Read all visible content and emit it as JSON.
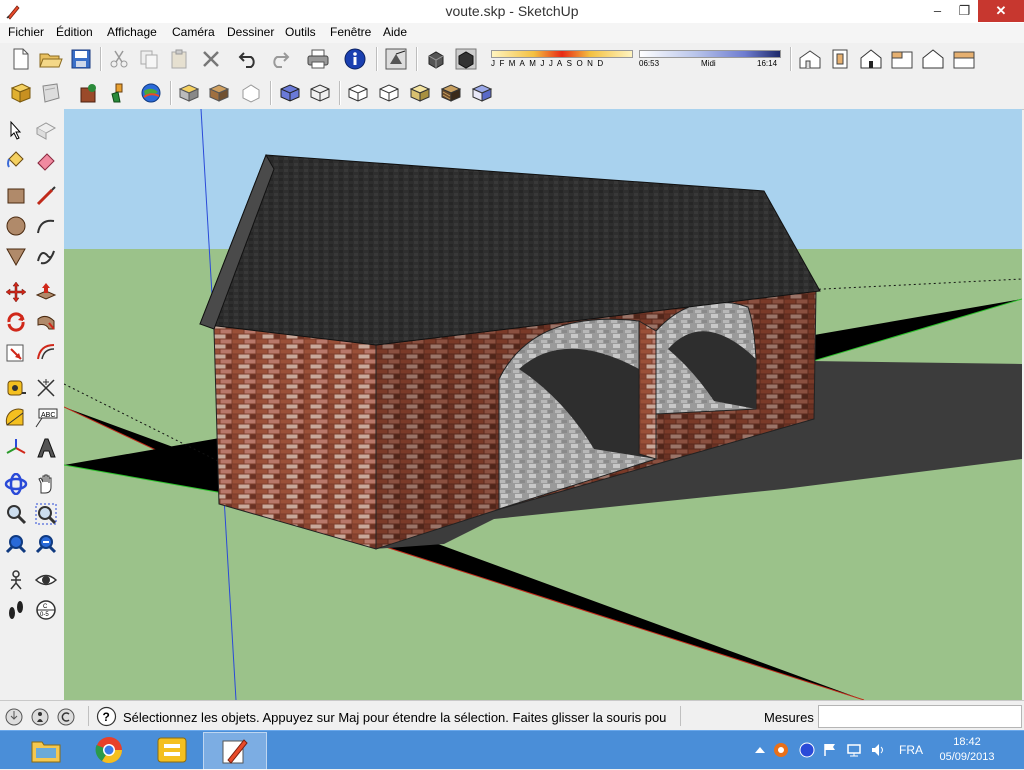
{
  "window": {
    "title": "voute.skp - SketchUp",
    "controls": {
      "minimize": "–",
      "maximize": "❐",
      "close": "✕"
    }
  },
  "menu": [
    {
      "name": "menu-fichier",
      "label": "Fichier"
    },
    {
      "name": "menu-edition",
      "label": "Édition"
    },
    {
      "name": "menu-affichage",
      "label": "Affichage"
    },
    {
      "name": "menu-camera",
      "label": "Caméra"
    },
    {
      "name": "menu-dessiner",
      "label": "Dessiner"
    },
    {
      "name": "menu-outils",
      "label": "Outils"
    },
    {
      "name": "menu-fenetre",
      "label": "Fenêtre"
    },
    {
      "name": "menu-aide",
      "label": "Aide"
    }
  ],
  "shadows": {
    "months": [
      "J",
      "F",
      "M",
      "A",
      "M",
      "J",
      "J",
      "A",
      "S",
      "O",
      "N",
      "D"
    ],
    "time_start": "06:53",
    "time_mid": "Midi",
    "time_end": "16:14"
  },
  "status": {
    "message": "Sélectionnez les objets. Appuyez sur Maj pour étendre la sélection. Faites glisser la souris pou",
    "measures_label": "Mesures",
    "measures_value": ""
  },
  "taskbar": {
    "language": "FRA",
    "time": "18:42",
    "date": "05/09/2013"
  },
  "colors": {
    "sky": "#a9d2ee",
    "ground": "#9bc28a",
    "brick": "#8b4a36",
    "roof": "#2b2b2b",
    "stone": "#a8a8a8",
    "taskbar": "#4a8ed8"
  },
  "icons": {
    "toolbar1": [
      "new-icon",
      "open-icon",
      "save-icon",
      "cut-icon",
      "copy-icon",
      "paste-icon",
      "delete-icon",
      "undo-icon",
      "redo-icon",
      "print-icon",
      "model-info-icon",
      "shadow-toggle-icon",
      "fog-toggle-icon",
      "iso-view-icon",
      "top-view-icon",
      "front-view-icon",
      "right-view-icon",
      "back-view-icon",
      "left-view-icon"
    ],
    "toolbar2": [
      "get-models-icon",
      "share-model-icon",
      "share-component-icon",
      "warehouse-icon",
      "google-earth-icon",
      "extension-warehouse-icon",
      "component-icon",
      "preview-icon",
      "xray-icon",
      "wireframe-icon",
      "hidden-line-icon",
      "shaded-icon",
      "shaded-textures-icon",
      "monochrome-icon"
    ],
    "tools": [
      "select-icon",
      "component-make-icon",
      "paint-bucket-icon",
      "eraser-icon",
      "rectangle-icon",
      "line-icon",
      "circle-icon",
      "arc-icon",
      "polygon-icon",
      "freehand-icon",
      "move-icon",
      "push-pull-icon",
      "rotate-icon",
      "follow-me-icon",
      "scale-icon",
      "offset-icon",
      "tape-measure-icon",
      "dimension-icon",
      "protractor-icon",
      "text-icon",
      "axes-icon",
      "3d-text-icon",
      "orbit-icon",
      "pan-icon",
      "zoom-icon",
      "zoom-window-icon",
      "zoom-extents-icon",
      "previous-view-icon",
      "position-camera-icon",
      "look-around-icon",
      "walk-icon",
      "section-plane-icon"
    ]
  }
}
